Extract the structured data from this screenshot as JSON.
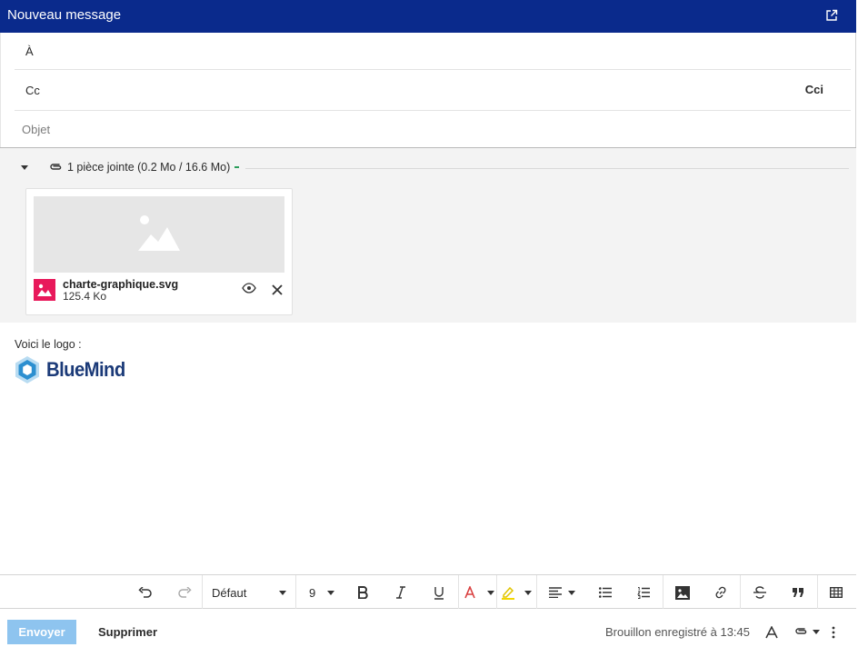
{
  "window": {
    "title": "Nouveau message",
    "popout_icon": "external-link-icon"
  },
  "recipients": {
    "to_label": "À",
    "to_value": "",
    "cc_label": "Cc",
    "cc_value": "",
    "bcc_toggle": "Cci"
  },
  "subject": {
    "placeholder": "Objet",
    "value": ""
  },
  "attachments": {
    "summary": "1 pièce jointe (0.2 Mo / 16.6 Mo)",
    "items": [
      {
        "name": "charte-graphique.svg",
        "size": "125.4 Ko",
        "type_icon": "image-file-icon"
      }
    ]
  },
  "body": {
    "text": "Voici le logo :",
    "logo_text": "BlueMind"
  },
  "toolbar": {
    "font_family": "Défaut",
    "font_size": "9",
    "items": [
      "undo-icon",
      "redo-icon",
      "bold-icon",
      "italic-icon",
      "underline-icon",
      "text-color-icon",
      "highlight-icon",
      "align-icon",
      "bullet-list-icon",
      "numbered-list-icon",
      "insert-image-icon",
      "link-icon",
      "strikethrough-icon",
      "quote-icon",
      "table-icon"
    ]
  },
  "footer": {
    "send_label": "Envoyer",
    "delete_label": "Supprimer",
    "draft_status": "Brouillon enregistré à 13:45"
  },
  "colors": {
    "header_bg": "#0a2a8c",
    "send_bg": "#8ec4ef",
    "file_icon": "#e8195b",
    "highlight": "#f2d600",
    "text_color": "#d93f3f",
    "logo_blue": "#1b3a78"
  }
}
